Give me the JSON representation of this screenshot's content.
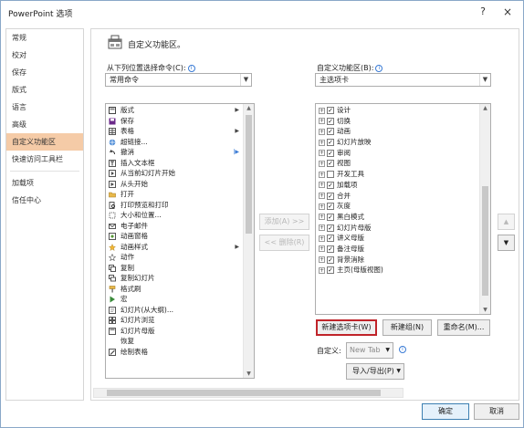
{
  "window": {
    "title": "PowerPoint 选项",
    "help": "?",
    "close": "×"
  },
  "sidebar": {
    "items": [
      {
        "label": "常规"
      },
      {
        "label": "校对"
      },
      {
        "label": "保存"
      },
      {
        "label": "版式"
      },
      {
        "label": "语言"
      },
      {
        "label": "高级"
      },
      {
        "label": "自定义功能区"
      },
      {
        "label": "快速访问工具栏"
      },
      {
        "label": "加载项"
      },
      {
        "label": "信任中心"
      }
    ]
  },
  "main": {
    "header": "自定义功能区。",
    "left": {
      "label": "从下列位置选择命令(C):",
      "combo_value": "常用命令",
      "commands": [
        {
          "label": "版式",
          "icon": "layout-icon",
          "sub": true
        },
        {
          "label": "保存",
          "icon": "save-icon"
        },
        {
          "label": "表格",
          "icon": "table-icon",
          "sub": true
        },
        {
          "label": "超链接...",
          "icon": "hyperlink-icon"
        },
        {
          "label": "撤消",
          "icon": "undo-icon",
          "sub": true
        },
        {
          "label": "插入文本框",
          "icon": "textbox-icon"
        },
        {
          "label": "从当前幻灯片开始",
          "icon": "play-current-icon"
        },
        {
          "label": "从头开始",
          "icon": "play-start-icon"
        },
        {
          "label": "打开",
          "icon": "open-folder-icon"
        },
        {
          "label": "打印预览和打印",
          "icon": "print-preview-icon"
        },
        {
          "label": "大小和位置...",
          "icon": "size-position-icon"
        },
        {
          "label": "电子邮件",
          "icon": "email-icon"
        },
        {
          "label": "动画窗格",
          "icon": "animation-pane-icon"
        },
        {
          "label": "动画样式",
          "icon": "animation-style-icon",
          "sub": true
        },
        {
          "label": "动作",
          "icon": "action-icon"
        },
        {
          "label": "复制",
          "icon": "copy-icon"
        },
        {
          "label": "复制幻灯片",
          "icon": "duplicate-slide-icon"
        },
        {
          "label": "格式刷",
          "icon": "format-painter-icon"
        },
        {
          "label": "宏",
          "icon": "macro-icon"
        },
        {
          "label": "幻灯片(从大纲)...",
          "icon": "slides-outline-icon"
        },
        {
          "label": "幻灯片浏览",
          "icon": "slide-sorter-icon"
        },
        {
          "label": "幻灯片母版",
          "icon": "slide-master-icon"
        },
        {
          "label": "恢复",
          "icon": "reset-icon"
        },
        {
          "label": "绘制表格",
          "icon": "draw-table-icon"
        }
      ]
    },
    "right": {
      "label": "自定义功能区(B):",
      "combo_value": "主选项卡",
      "tabs": [
        {
          "label": "设计",
          "checked": true
        },
        {
          "label": "切换",
          "checked": true
        },
        {
          "label": "动画",
          "checked": true
        },
        {
          "label": "幻灯片放映",
          "checked": true
        },
        {
          "label": "审阅",
          "checked": true
        },
        {
          "label": "视图",
          "checked": true
        },
        {
          "label": "开发工具",
          "checked": false
        },
        {
          "label": "加载项",
          "checked": true
        },
        {
          "label": "合并",
          "checked": true
        },
        {
          "label": "灰度",
          "checked": true
        },
        {
          "label": "黑白模式",
          "checked": true
        },
        {
          "label": "幻灯片母版",
          "checked": true
        },
        {
          "label": "讲义母版",
          "checked": true
        },
        {
          "label": "备注母版",
          "checked": true
        },
        {
          "label": "背景消除",
          "checked": true
        },
        {
          "label": "主页(母版视图)",
          "checked": true
        }
      ]
    },
    "add_button": "添加(A) >>",
    "remove_button": "<< 删除(R)",
    "new_tab_button": "新建选项卡(W)",
    "new_group_button": "新建组(N)",
    "rename_button": "重命名(M)...",
    "customize_label": "自定义:",
    "customize_value": "New Tab",
    "import_export_button": "导入/导出(P)"
  },
  "footer": {
    "ok": "确定",
    "cancel": "取消"
  }
}
